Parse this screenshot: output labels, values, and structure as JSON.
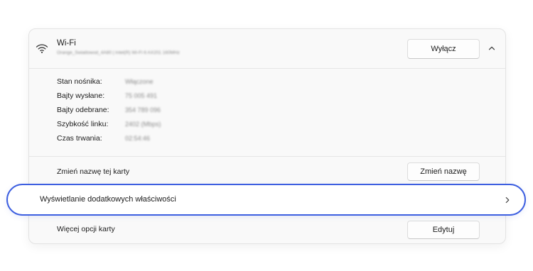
{
  "wifi": {
    "icon": "wifi-icon",
    "title": "Wi-Fi",
    "adapter": "Orange_Swiatlowod_4A80 | Intel(R) Wi-Fi 6 AX201 160MHz",
    "disable_button": "Wyłącz"
  },
  "properties": [
    {
      "label": "Stan nośnika:",
      "value": "Włączone"
    },
    {
      "label": "Bajty wysłane:",
      "value": "75 005 491"
    },
    {
      "label": "Bajty odebrane:",
      "value": "354 789 096"
    },
    {
      "label": "Szybkość linku:",
      "value": "2402 (Mbps)"
    },
    {
      "label": "Czas trwania:",
      "value": "02:54:46"
    }
  ],
  "rename": {
    "label": "Zmień nazwę tej karty",
    "button": "Zmień nazwę"
  },
  "view_more": {
    "label": "Wyświetlanie dodatkowych właściwości"
  },
  "more_options": {
    "label": "Więcej opcji karty",
    "button": "Edytuj"
  },
  "colors": {
    "highlight": "#3d5fe0"
  }
}
